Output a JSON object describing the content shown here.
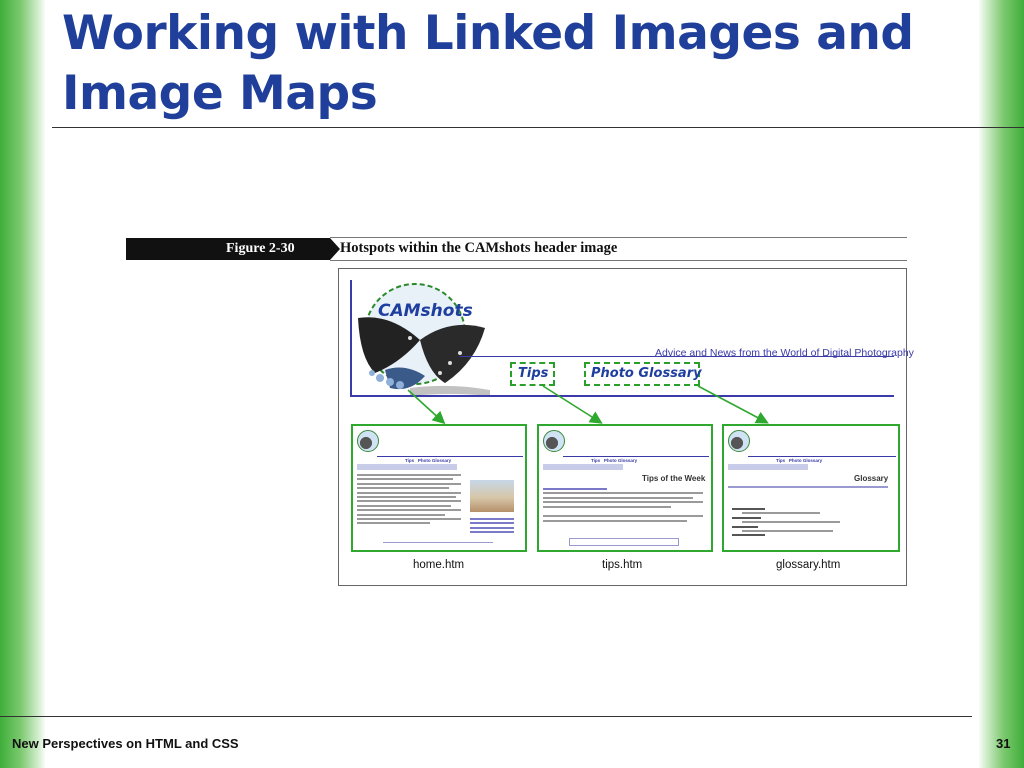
{
  "slide": {
    "title": "Working with Linked Images and Image Maps"
  },
  "figure": {
    "label": "Figure 2-30",
    "caption": "Hotspots within the CAMshots header image",
    "tagline": "Advice and News from the World of Digital Photography",
    "hotspots": {
      "tips": "Tips",
      "glossary": "Photo Glossary"
    },
    "thumbs": {
      "tips_heading": "Tips of the Week",
      "glossary_heading": "Glossary"
    },
    "captions": {
      "home": "home.htm",
      "tips": "tips.htm",
      "glossary": "glossary.htm"
    }
  },
  "footer": {
    "text": "New Perspectives on HTML and CSS",
    "page": "31"
  },
  "colors": {
    "title": "#1f3f9a",
    "accent_green": "#2ea82e",
    "link_blue": "#3a3aa8"
  }
}
